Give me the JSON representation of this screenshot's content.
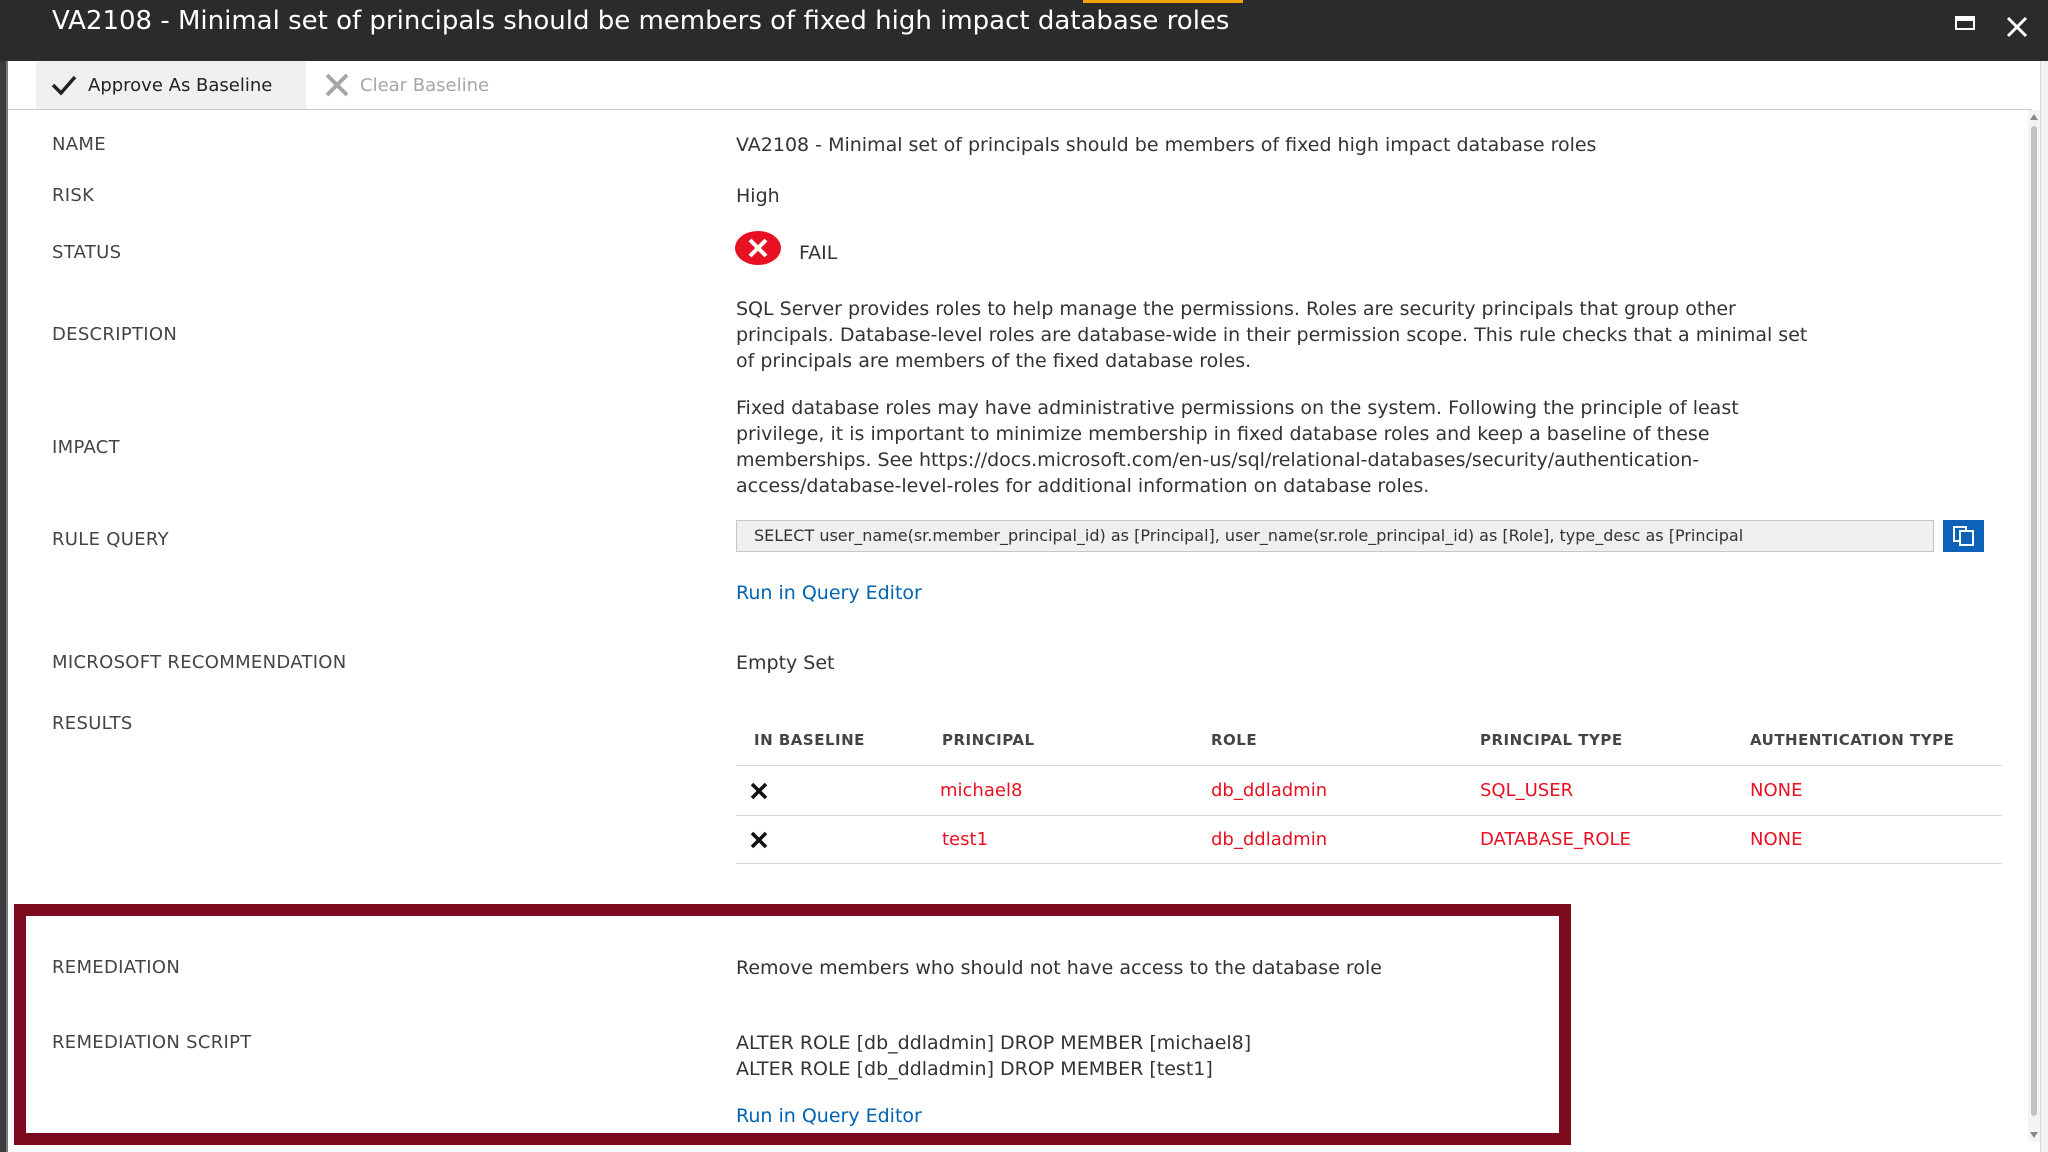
{
  "window": {
    "title": "VA2108 - Minimal set of principals should be members of fixed high impact database roles",
    "maximize_icon": "maximize-icon",
    "close_icon": "close-icon"
  },
  "toolbar": {
    "approve_label": "Approve As Baseline",
    "clear_label": "Clear Baseline"
  },
  "fields": {
    "name_label": "NAME",
    "name_value": "VA2108 - Minimal set of principals should be members of fixed high impact database roles",
    "risk_label": "RISK",
    "risk_value": "High",
    "status_label": "STATUS",
    "status_value": "FAIL",
    "description_label": "DESCRIPTION",
    "description_lines": [
      "SQL Server provides roles to help manage the permissions. Roles are security principals that group other",
      "principals. Database-level roles are database-wide in their permission scope. This rule checks that a minimal set",
      "of principals are members of the fixed database roles."
    ],
    "impact_label": "IMPACT",
    "impact_lines": [
      "Fixed database roles may have administrative permissions on the system. Following the principle of least",
      "privilege, it is important to minimize membership in fixed database roles and keep a baseline of these",
      "memberships. See https://docs.microsoft.com/en-us/sql/relational-databases/security/authentication-",
      "access/database-level-roles for additional information on database roles."
    ],
    "rule_query_label": "RULE QUERY",
    "rule_query_value": "SELECT user_name(sr.member_principal_id) as [Principal], user_name(sr.role_principal_id) as [Role], type_desc as [Principal",
    "run_query_link": "Run in Query Editor",
    "recommendation_label": "MICROSOFT RECOMMENDATION",
    "recommendation_value": "Empty Set",
    "results_label": "RESULTS",
    "remediation_label": "REMEDIATION",
    "remediation_value": "Remove members who should not have access to the database role",
    "remediation_script_label": "REMEDIATION SCRIPT",
    "remediation_script_lines": [
      "ALTER ROLE [db_ddladmin] DROP MEMBER [michael8]",
      "ALTER ROLE [db_ddladmin] DROP MEMBER [test1]"
    ],
    "remediation_run_link": "Run in Query Editor"
  },
  "results": {
    "columns": [
      "IN BASELINE",
      "PRINCIPAL",
      "ROLE",
      "PRINCIPAL TYPE",
      "AUTHENTICATION TYPE"
    ],
    "rows": [
      {
        "principal": "michael8",
        "role": "db_ddladmin",
        "principal_type": "SQL_USER",
        "authentication_type": "NONE"
      },
      {
        "principal": "test1",
        "role": "db_ddladmin",
        "principal_type": "DATABASE_ROLE",
        "authentication_type": "NONE"
      }
    ]
  },
  "colors": {
    "titlebar": "#2b2b2b",
    "fail_red": "#e81123",
    "link_blue": "#0063b1",
    "highlight_border": "#7d0a1e"
  }
}
